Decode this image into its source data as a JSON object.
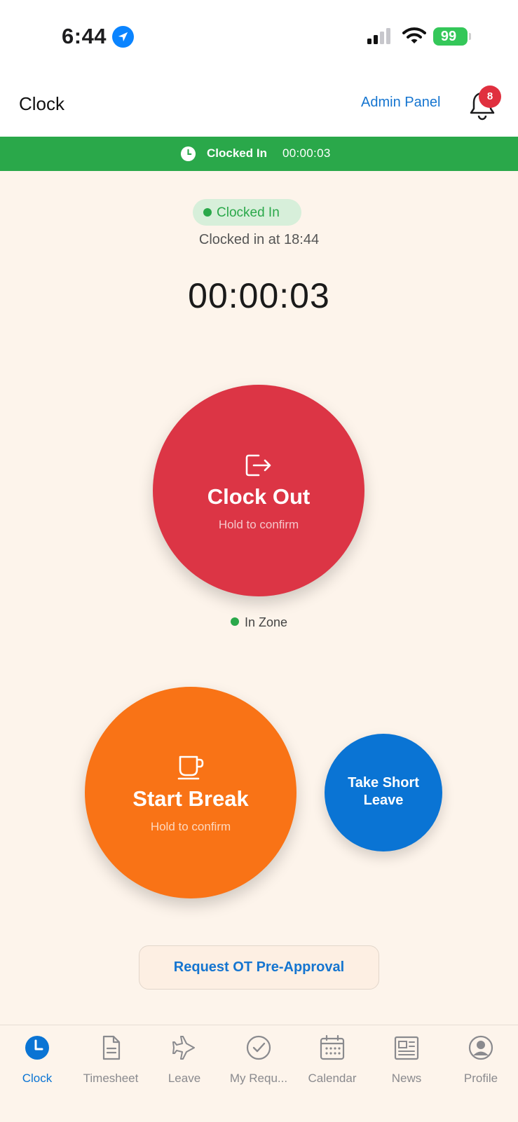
{
  "status_bar": {
    "time": "6:44",
    "battery": "99"
  },
  "header": {
    "title": "Clock",
    "admin_link": "Admin Panel",
    "notification_count": "8"
  },
  "banner": {
    "label": "Clocked In",
    "timer": "00:00:03"
  },
  "clock_status": {
    "pill_label": "Clocked In",
    "clocked_in_at": "Clocked in at 18:44",
    "timer": "00:00:03"
  },
  "actions": {
    "clock_out": {
      "title": "Clock Out",
      "subtitle": "Hold to confirm"
    },
    "zone_label": "In Zone",
    "start_break": {
      "title": "Start Break",
      "subtitle": "Hold to confirm"
    },
    "short_leave": {
      "line1": "Take Short",
      "line2": "Leave"
    },
    "ot_request": "Request OT Pre-Approval"
  },
  "tabs": [
    {
      "label": "Clock",
      "icon": "clock-icon",
      "active": true
    },
    {
      "label": "Timesheet",
      "icon": "document-icon",
      "active": false
    },
    {
      "label": "Leave",
      "icon": "airplane-icon",
      "active": false
    },
    {
      "label": "My Requ...",
      "icon": "check-circle-icon",
      "active": false
    },
    {
      "label": "Calendar",
      "icon": "calendar-icon",
      "active": false
    },
    {
      "label": "News",
      "icon": "newspaper-icon",
      "active": false
    },
    {
      "label": "Profile",
      "icon": "profile-icon",
      "active": false
    }
  ],
  "colors": {
    "background": "#fdf4eb",
    "banner_green": "#2aa84a",
    "clock_out_red": "#dc3545",
    "break_orange": "#f97316",
    "leave_blue": "#0a74d4",
    "link_blue": "#1575d0"
  }
}
